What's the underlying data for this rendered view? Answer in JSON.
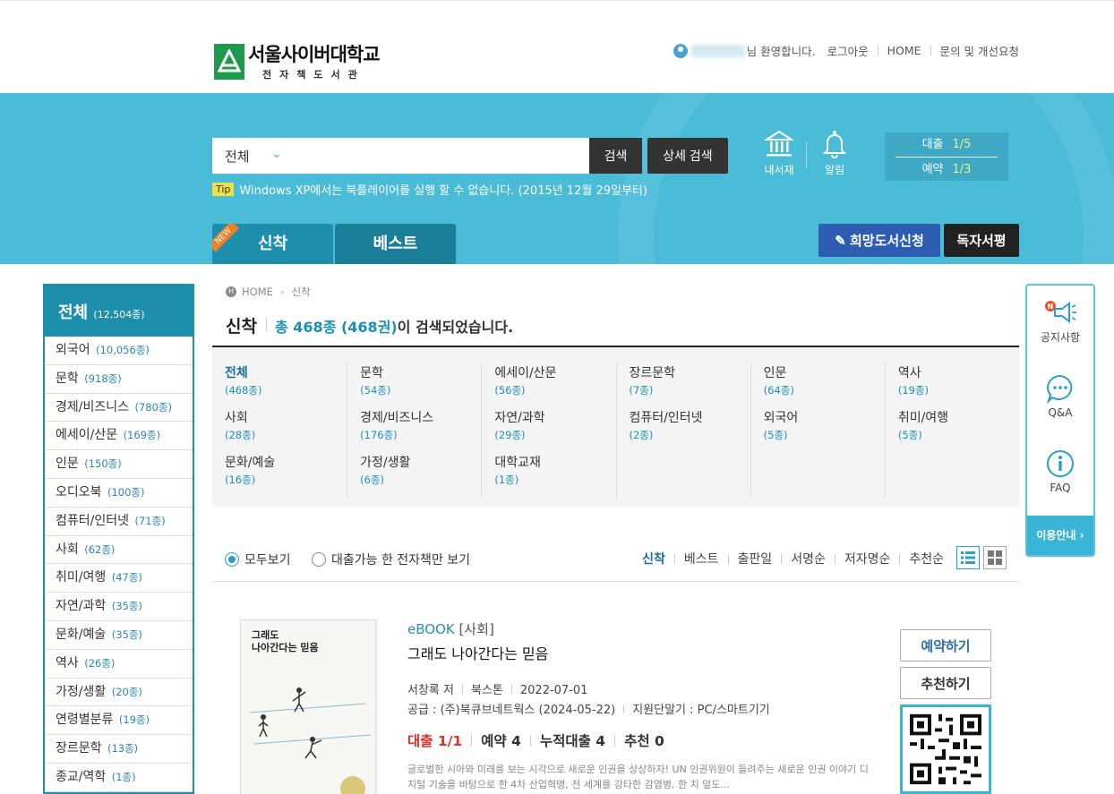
{
  "header": {
    "logo_title": "서울사이버대학교",
    "logo_sub": "전자책도서관",
    "welcome": "님 환영합니다.",
    "logout": "로그아웃",
    "home": "HOME",
    "inquiry": "문의 및 개선요청"
  },
  "search": {
    "scope": "전체",
    "button": "검색",
    "advanced": "상세 검색",
    "tip_badge": "Tip",
    "tip_text": "Windows XP에서는 북플레이어를 실행 할 수 없습니다. (2015년 12월 29일부터)"
  },
  "band": {
    "mylib": "내서재",
    "alarm": "알림",
    "loan_label": "대출",
    "loan_value": "1/5",
    "reserve_label": "예약",
    "reserve_value": "1/3",
    "tab_new": "신착",
    "tab_best": "베스트",
    "new_ribbon": "NEW",
    "wish_button": "희망도서신청",
    "review_button": "독자서평"
  },
  "sidebar": {
    "title": "전체",
    "title_count": "(12,504종)",
    "items": [
      {
        "label": "외국어",
        "count": "(10,056종)"
      },
      {
        "label": "문학",
        "count": "(918종)"
      },
      {
        "label": "경제/비즈니스",
        "count": "(780종)"
      },
      {
        "label": "에세이/산문",
        "count": "(169종)"
      },
      {
        "label": "인문",
        "count": "(150종)"
      },
      {
        "label": "오디오북",
        "count": "(100종)"
      },
      {
        "label": "컴퓨터/인터넷",
        "count": "(71종)"
      },
      {
        "label": "사회",
        "count": "(62종)"
      },
      {
        "label": "취미/여행",
        "count": "(47종)"
      },
      {
        "label": "자연/과학",
        "count": "(35종)"
      },
      {
        "label": "문화/예술",
        "count": "(35종)"
      },
      {
        "label": "역사",
        "count": "(26종)"
      },
      {
        "label": "가정/생활",
        "count": "(20종)"
      },
      {
        "label": "연령별분류",
        "count": "(19종)"
      },
      {
        "label": "장르문학",
        "count": "(13종)"
      },
      {
        "label": "종교/역학",
        "count": "(1종)"
      }
    ]
  },
  "breadcrumb": {
    "home": "HOME",
    "current": "신착"
  },
  "page": {
    "title": "신착",
    "count_highlight": "총 468종 (468권)",
    "count_rest": "이 검색되었습니다."
  },
  "categories": [
    {
      "name": "전체",
      "count": "(468종)"
    },
    {
      "name": "문학",
      "count": "(54종)"
    },
    {
      "name": "에세이/산문",
      "count": "(56종)"
    },
    {
      "name": "장르문학",
      "count": "(7종)"
    },
    {
      "name": "인문",
      "count": "(64종)"
    },
    {
      "name": "역사",
      "count": "(19종)"
    },
    {
      "name": "사회",
      "count": "(28종)"
    },
    {
      "name": "경제/비즈니스",
      "count": "(176종)"
    },
    {
      "name": "자연/과학",
      "count": "(29종)"
    },
    {
      "name": "컴퓨터/인터넷",
      "count": "(2종)"
    },
    {
      "name": "외국어",
      "count": "(5종)"
    },
    {
      "name": "취미/여행",
      "count": "(5종)"
    },
    {
      "name": "문화/예술",
      "count": "(16종)"
    },
    {
      "name": "가정/생활",
      "count": "(6종)"
    },
    {
      "name": "대학교재",
      "count": "(1종)"
    }
  ],
  "filters": {
    "all": "모두보기",
    "available": "대출가능 한 전자책만 보기"
  },
  "sort": [
    "신착",
    "베스트",
    "출판일",
    "서명순",
    "저자명순",
    "추천순"
  ],
  "book": {
    "format": "eBOOK",
    "category": "[사회]",
    "title": "그래도 나아간다는 믿음",
    "author": "서창록 저",
    "publisher": "북스톤",
    "date": "2022-07-01",
    "supply": "공급 : (주)북큐브네트웍스 (2024-05-22)",
    "device": "지원단말기 : PC/스마트기기",
    "loan": "대출 1/1",
    "reserve": "예약 4",
    "total_loan": "누적대출 4",
    "recommend": "추천 0",
    "desc": "글로벌한 시아와 미래를 보는 시각으로 새로운 인권을 상상하자! UN 인권위원이 들려주는 새로운 인권 이야기 디지털 기술을 바탕으로 한 4차 산업혁명, 전 세계를 강타한 감염병, 한 치 앞도...",
    "cover_title": "그래도\n나아간다는 믿음",
    "reserve_button": "예약하기",
    "recommend_button": "추천하기"
  },
  "quick": {
    "notice": "공지사항",
    "qna": "Q&A",
    "faq": "FAQ",
    "guide": "이용안내 ›"
  }
}
